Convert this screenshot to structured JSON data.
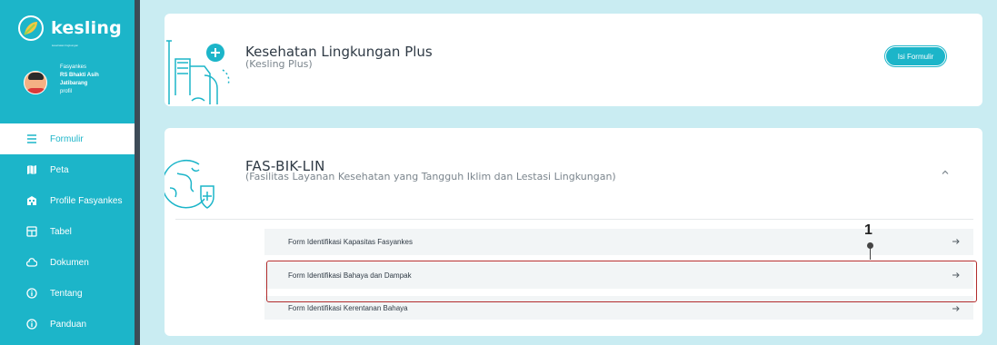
{
  "app": {
    "logo_text": "kesling",
    "logo_tagline": "kesehatan lingkungan"
  },
  "profile": {
    "role": "Fasyankes",
    "name": "RS Bhakti Asih Jatibarang",
    "link": "profil"
  },
  "sidebar": {
    "items": [
      {
        "label": "Formulir",
        "icon": "list-icon",
        "active": true
      },
      {
        "label": "Peta",
        "icon": "map-icon",
        "active": false
      },
      {
        "label": "Profile Fasyankes",
        "icon": "building-icon",
        "active": false
      },
      {
        "label": "Tabel",
        "icon": "table-icon",
        "active": false
      },
      {
        "label": "Dokumen",
        "icon": "cloud-icon",
        "active": false
      },
      {
        "label": "Tentang",
        "icon": "info-icon",
        "active": false
      },
      {
        "label": "Panduan",
        "icon": "info-icon",
        "active": false
      }
    ]
  },
  "card_kesling_plus": {
    "title": "Kesehatan Lingkungan Plus",
    "subtitle": "(Kesling Plus)",
    "button_label": "Isi Formulir"
  },
  "card_fasbiklin": {
    "title": "FAS-BIK-LIN",
    "subtitle": "(Fasilitas Layanan Kesehatan yang Tangguh Iklim dan Lestasi Lingkungan)",
    "forms": [
      {
        "label": "Form Identifikasi Kapasitas Fasyankes"
      },
      {
        "label": "Form Identifikasi Bahaya dan Dampak"
      },
      {
        "label": "Form Identifikasi Kerentanan Bahaya"
      }
    ]
  },
  "annotation": {
    "number": "1"
  },
  "colors": {
    "accent": "#1cb5c9",
    "background": "#c9ecf2",
    "highlight": "#b22c2c"
  }
}
